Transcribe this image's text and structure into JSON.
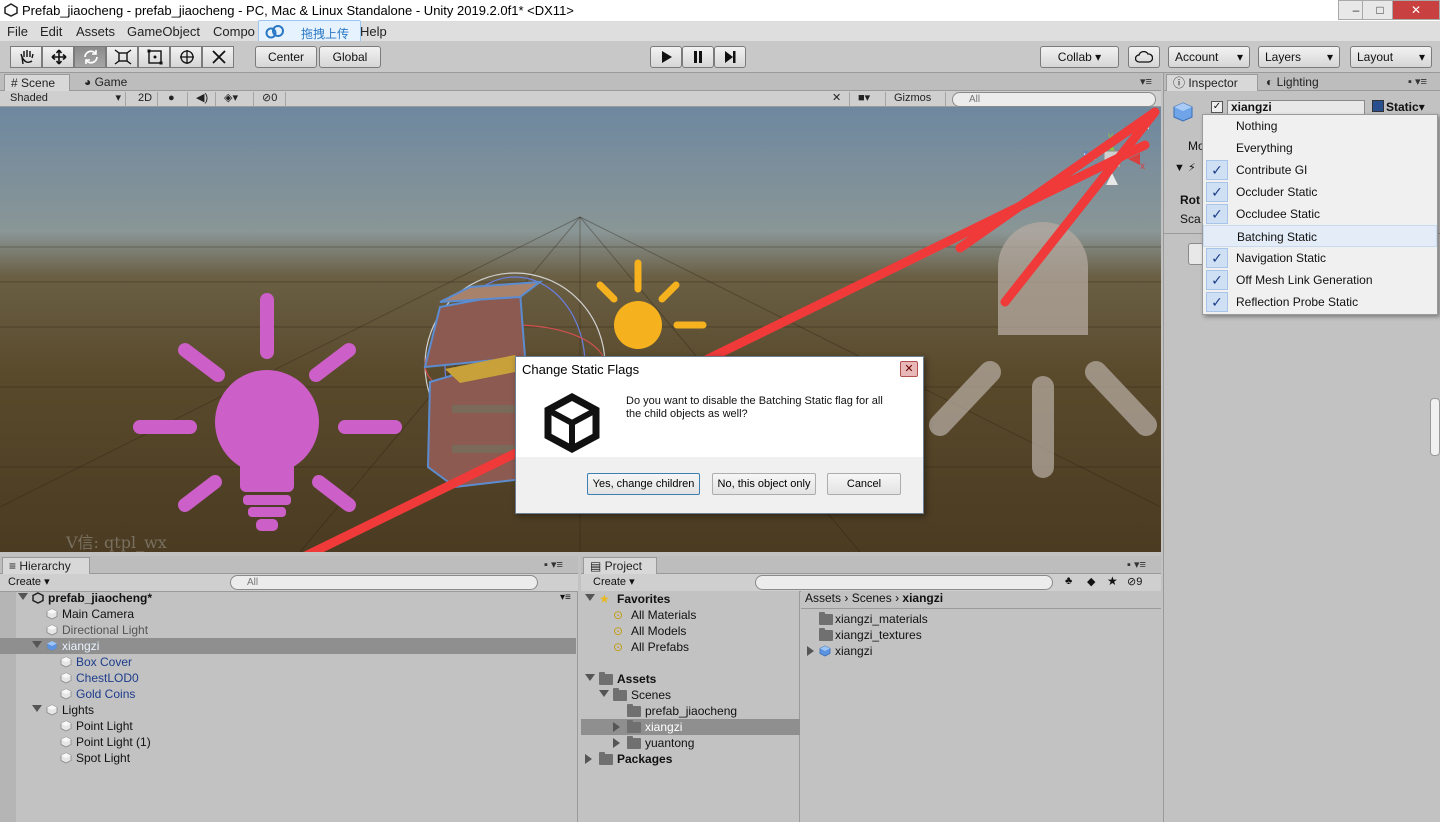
{
  "window": {
    "title": "Prefab_jiaocheng - prefab_jiaocheng - PC, Mac & Linux Standalone - Unity 2019.2.0f1* <DX11>",
    "minimize": "–",
    "maximize": "□",
    "close": "✕"
  },
  "menubar": [
    "File",
    "Edit",
    "Assets",
    "GameObject",
    "Compo",
    "Help"
  ],
  "upload_overlay": {
    "label": "拖拽上传"
  },
  "toolbar": {
    "pivot": "Center",
    "space": "Global",
    "collab": "Collab ▾",
    "account": "Account",
    "layers": "Layers",
    "layout": "Layout"
  },
  "scene": {
    "tabs": [
      "Scene",
      "Game"
    ],
    "shading": "Shaded",
    "mode2d": "2D",
    "hidden_count": "0",
    "gizmos": "Gizmos",
    "search_placeholder": "All",
    "watermark": "V信: qtpl_wx"
  },
  "dialog": {
    "title": "Change Static Flags",
    "message": "Do you want to disable the Batching Static flag for all the child objects as well?",
    "buttons": [
      "Yes, change children",
      "No, this object only",
      "Cancel"
    ],
    "close": "✕"
  },
  "hierarchy": {
    "tab": "Hierarchy",
    "create": "Create",
    "search_placeholder": "All",
    "rows": [
      {
        "label": "prefab_jiaocheng*",
        "depth": 0,
        "expanded": true,
        "kind": "scene"
      },
      {
        "label": "Main Camera",
        "depth": 1,
        "kind": "object"
      },
      {
        "label": "Directional Light",
        "depth": 1,
        "kind": "dim"
      },
      {
        "label": "xiangzi",
        "depth": 1,
        "expanded": true,
        "kind": "prefab-root",
        "selected": true
      },
      {
        "label": "Box Cover",
        "depth": 2,
        "kind": "prefab"
      },
      {
        "label": "ChestLOD0",
        "depth": 2,
        "kind": "prefab"
      },
      {
        "label": "Gold Coins",
        "depth": 2,
        "kind": "prefab"
      },
      {
        "label": "Lights",
        "depth": 1,
        "expanded": true,
        "kind": "object"
      },
      {
        "label": "Point Light",
        "depth": 2,
        "kind": "object"
      },
      {
        "label": "Point Light (1)",
        "depth": 2,
        "kind": "object"
      },
      {
        "label": "Spot Light",
        "depth": 2,
        "kind": "object"
      }
    ]
  },
  "project": {
    "tab": "Project",
    "create": "Create",
    "hidden_count": "9",
    "breadcrumb": [
      "Assets",
      "Scenes",
      "xiangzi"
    ],
    "tree": [
      {
        "label": "Favorites",
        "depth": 0,
        "bold": true,
        "icon": "star"
      },
      {
        "label": "All Materials",
        "depth": 1,
        "icon": "search"
      },
      {
        "label": "All Models",
        "depth": 1,
        "icon": "search"
      },
      {
        "label": "All Prefabs",
        "depth": 1,
        "icon": "search"
      },
      {
        "label": "",
        "depth": 0,
        "icon": "none"
      },
      {
        "label": "Assets",
        "depth": 0,
        "bold": true,
        "icon": "folder"
      },
      {
        "label": "Scenes",
        "depth": 1,
        "icon": "folder"
      },
      {
        "label": "prefab_jiaocheng",
        "depth": 2,
        "icon": "folder"
      },
      {
        "label": "xiangzi",
        "depth": 2,
        "icon": "folder",
        "selected": true,
        "collapsed": true
      },
      {
        "label": "yuantong",
        "depth": 2,
        "icon": "folder",
        "collapsed": true
      },
      {
        "label": "Packages",
        "depth": 0,
        "bold": true,
        "icon": "folder",
        "collapsed": true
      }
    ],
    "files": [
      {
        "label": "xiangzi_materials",
        "icon": "folder"
      },
      {
        "label": "xiangzi_textures",
        "icon": "folder"
      },
      {
        "label": "xiangzi",
        "icon": "prefab"
      }
    ]
  },
  "inspector": {
    "tabs": [
      "Inspector",
      "Lighting"
    ],
    "object_name": "xiangzi",
    "static_label": "Static",
    "partial_labels": [
      "Mo",
      "Rot",
      "Sca"
    ],
    "static_menu": [
      {
        "label": "Nothing",
        "checked": false
      },
      {
        "label": "Everything",
        "checked": false
      },
      {
        "label": "Contribute GI",
        "checked": true
      },
      {
        "label": "Occluder Static",
        "checked": true
      },
      {
        "label": "Occludee Static",
        "checked": true
      },
      {
        "label": "Batching Static",
        "checked": false,
        "hover": true
      },
      {
        "label": "Navigation Static",
        "checked": true
      },
      {
        "label": "Off Mesh Link Generation",
        "checked": true
      },
      {
        "label": "Reflection Probe Static",
        "checked": true
      }
    ]
  },
  "colors": {
    "annotation_arrow": "#f03a3a",
    "light_icon": "#cc5fc8",
    "sun_icon": "#f5b21e",
    "selection": "#8f8f8f"
  }
}
